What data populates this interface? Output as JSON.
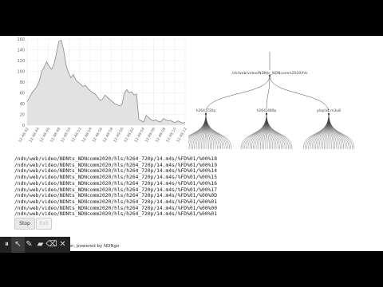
{
  "chart_data": {
    "type": "area",
    "title": "",
    "xlabel": "",
    "ylabel": "",
    "ylim": [
      0,
      160
    ],
    "yticks": [
      0,
      20,
      40,
      60,
      80,
      100,
      120,
      140,
      160
    ],
    "xticks": [
      "12:48:42",
      "12:48:44",
      "12:48:46",
      "12:48:48",
      "12:48:50",
      "12:48:52",
      "12:48:54",
      "12:48:56",
      "12:48:58",
      "12:49:00",
      "12:49:02",
      "12:49:04",
      "12:49:06",
      "12:49:08",
      "12:49:10",
      "12:49:12"
    ],
    "series": [
      {
        "values": [
          44,
          52,
          60,
          66,
          72,
          82,
          100,
          108,
          118,
          110,
          104,
          112,
          132,
          155,
          158,
          140,
          112,
          98,
          88,
          94,
          84,
          80,
          76,
          72,
          74,
          68,
          64,
          60,
          58,
          52,
          46,
          48,
          56,
          52,
          48,
          44,
          40,
          38,
          36,
          38,
          60,
          66,
          60,
          62,
          56,
          58,
          10,
          8,
          6,
          18,
          14,
          10,
          8,
          10,
          7,
          6,
          12,
          10,
          8,
          9,
          6,
          5,
          8,
          6,
          4,
          5
        ]
      }
    ]
  },
  "tree": {
    "root": "/sh/web/video/NDNts_NDNcomm2020/hls",
    "children": [
      "h264_720p",
      "h264_480p",
      "playlist.m3u8"
    ]
  },
  "log_lines": [
    "/ndn/web/video/NDNts_NDNcomm2020/hls/h264_720p/14.m4s/%FD%01/%00%18",
    "/ndn/web/video/NDNts_NDNcomm2020/hls/h264_720p/14.m4s/%FD%01/%00%19",
    "/ndn/web/video/NDNts_NDNcomm2020/hls/h264_720p/14.m4s/%FD%01/%00%14",
    "/ndn/web/video/NDNts_NDNcomm2020/hls/h264_720p/14.m4s/%FD%01/%00%15",
    "/ndn/web/video/NDNts_NDNcomm2020/hls/h264_720p/14.m4s/%FD%01/%00%16",
    "/ndn/web/video/NDNts_NDNcomm2020/hls/h264_720p/14.m4s/%FD%01/%00%17",
    "/ndn/web/video/NDNts_NDNcomm2020/hls/h264_720p/14.m4s/%FD%01/%00%0D",
    "/ndn/web/video/NDNts_NDNcomm2020/hls/h264_720p/14.m4s/%FD%01/%00%01",
    "/ndn/web/video/NDNts_NDNcomm2020/hls/h264_720p/14.m4s/%FD%01/%00%00",
    "/ndn/web/video/NDNts_NDNcomm2020/hls/h264_720p/14.m4s/%FD%01/%00%01"
  ],
  "buttons": {
    "stop": "Stop",
    "exit": "Exit"
  },
  "footer": "zer, powered by NDNgo",
  "toolbar": {
    "icons": [
      "pause-icon",
      "pointer-icon",
      "pen-icon",
      "highlighter-icon",
      "eraser-icon",
      "close-icon"
    ],
    "glyphs": [
      "⏸",
      "↖",
      "✎",
      "▰",
      "⌫",
      "✕"
    ],
    "selected": "pointer-icon"
  },
  "colors": {
    "area_fill": "#e2e2e2",
    "area_stroke": "#8a8a8a",
    "grid": "#ececec",
    "tree_line": "#444444"
  }
}
